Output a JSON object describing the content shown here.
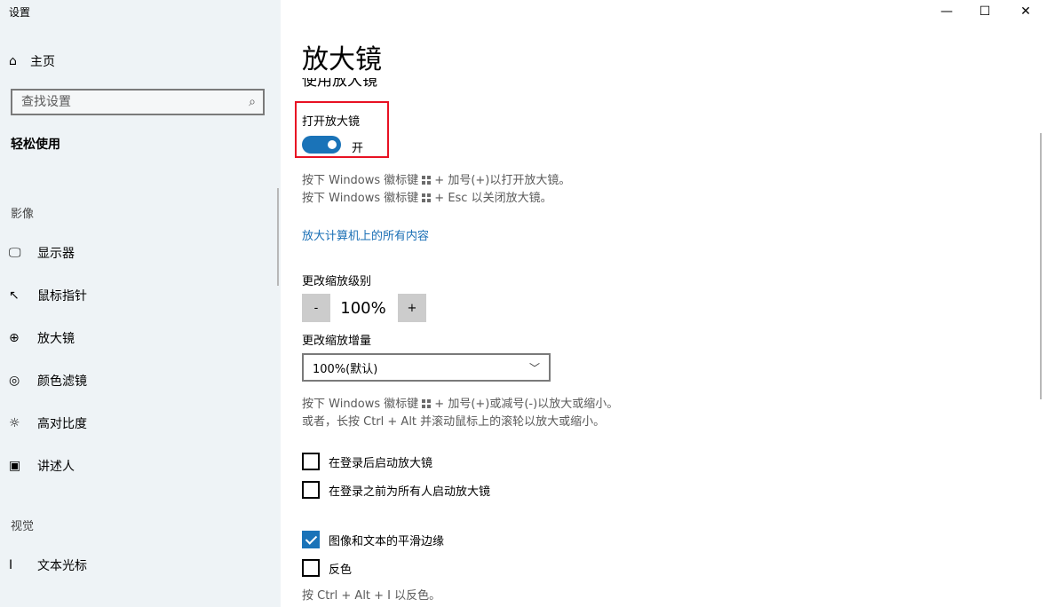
{
  "app_title": "设置",
  "sidebar": {
    "home_label": "主页",
    "search_placeholder": "查找设置",
    "category": "轻松使用",
    "sections": [
      {
        "label": "影像",
        "items": [
          {
            "label": "显示器",
            "icon": "monitor-icon"
          },
          {
            "label": "鼠标指针",
            "icon": "mouse-pointer-icon"
          },
          {
            "label": "放大镜",
            "icon": "magnifier-icon"
          },
          {
            "label": "颜色滤镜",
            "icon": "color-palette-icon"
          },
          {
            "label": "高对比度",
            "icon": "brightness-icon"
          },
          {
            "label": "讲述人",
            "icon": "narrator-icon"
          }
        ]
      },
      {
        "label": "视觉",
        "items": [
          {
            "label": "文本光标",
            "icon": "text-cursor-icon"
          }
        ]
      }
    ]
  },
  "window_controls": {
    "minimize": "—",
    "maximize": "☐",
    "close": "✕"
  },
  "main": {
    "page_title": "放大镜",
    "section_heading": "使用放大镜",
    "toggle": {
      "label": "打开放大镜",
      "state": "开",
      "on": true
    },
    "shortcut_hints": [
      {
        "pre": "按下 Windows 徽标键",
        "post": "+ 加号(+)以打开放大镜。"
      },
      {
        "pre": "按下 Windows 徽标键",
        "post": "+ Esc 以关闭放大镜。"
      }
    ],
    "link": "放大计算机上的所有内容",
    "zoom_level": {
      "label": "更改缩放级别",
      "minus": "-",
      "plus": "+",
      "value": "100%"
    },
    "zoom_increment": {
      "label": "更改缩放增量",
      "selected": "100%(默认)"
    },
    "zoom_hints": [
      {
        "pre": "按下 Windows 徽标键",
        "post": "+ 加号(+)或减号(-)以放大或缩小。"
      },
      {
        "text": "或者，长按 Ctrl + Alt 并滚动鼠标上的滚轮以放大或缩小。"
      }
    ],
    "checkboxes": [
      {
        "label": "在登录后启动放大镜",
        "checked": false
      },
      {
        "label": "在登录之前为所有人启动放大镜",
        "checked": false
      },
      {
        "label": "图像和文本的平滑边缘",
        "checked": true
      },
      {
        "label": "反色",
        "checked": false
      }
    ],
    "invert_hint": "按 Ctrl + Alt + I 以反色。"
  },
  "colors": {
    "accent": "#1a73b8",
    "link": "#1a6fb5",
    "sidebar_bg": "#eef3f6",
    "highlight": "#e81123"
  }
}
